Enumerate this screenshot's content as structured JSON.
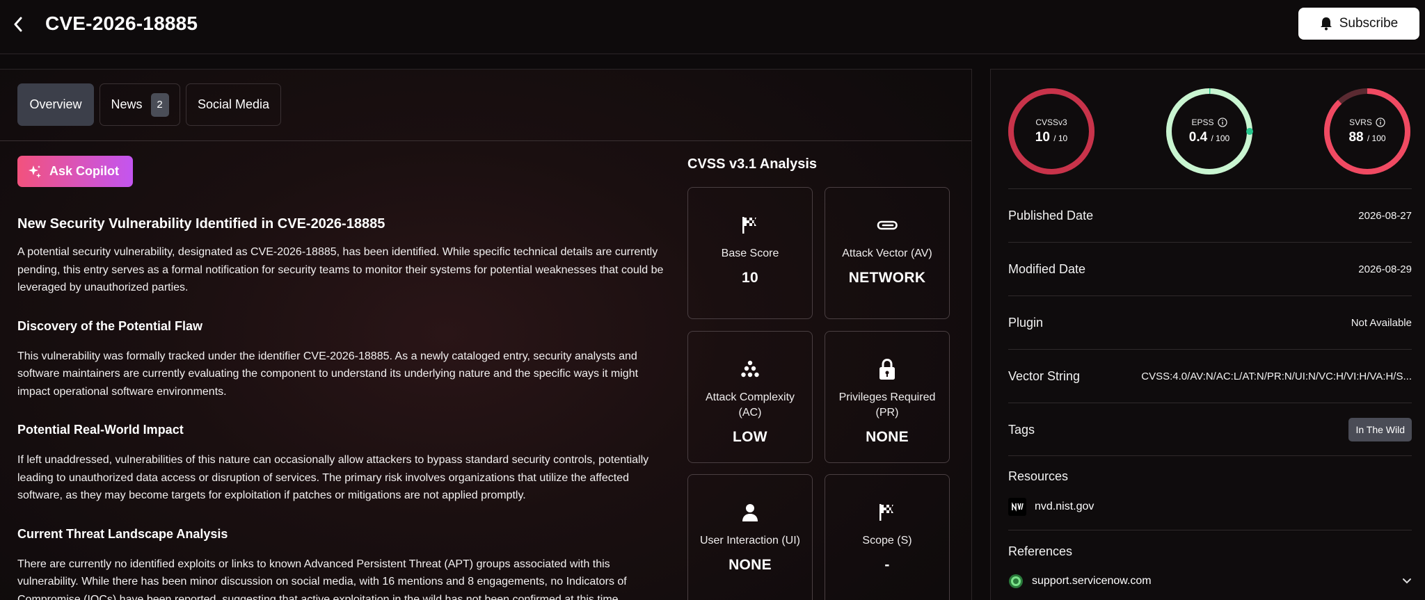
{
  "header": {
    "title": "CVE-2026-18885",
    "subscribe_label": "Subscribe"
  },
  "tabs": [
    {
      "label": "Overview",
      "active": true
    },
    {
      "label": "News",
      "count": "2"
    },
    {
      "label": "Social Media"
    }
  ],
  "copilot_label": "Ask Copilot",
  "article": {
    "title": "New Security Vulnerability Identified in CVE-2026-18885",
    "intro": "A potential security vulnerability, designated as CVE-2026-18885, has been identified. While specific technical details are currently pending, this entry serves as a formal notification for security teams to monitor their systems for potential weaknesses that could be leveraged by unauthorized parties.",
    "sections": [
      {
        "heading": "Discovery of the Potential Flaw",
        "body": "This vulnerability was formally tracked under the identifier CVE-2026-18885. As a newly cataloged entry, security analysts and software maintainers are currently evaluating the component to understand its underlying nature and the specific ways it might impact operational software environments."
      },
      {
        "heading": "Potential Real-World Impact",
        "body": "If left unaddressed, vulnerabilities of this nature can occasionally allow attackers to bypass standard security controls, potentially leading to unauthorized data access or disruption of services. The primary risk involves organizations that utilize the affected software, as they may become targets for exploitation if patches or mitigations are not applied promptly."
      },
      {
        "heading": "Current Threat Landscape Analysis",
        "body": "There are currently no identified exploits or links to known Advanced Persistent Threat (APT) groups associated with this vulnerability. While there has been minor discussion on social media, with 16 mentions and 8 engagements, no Indicators of Compromise (IOCs) have been reported, suggesting that active exploitation in the wild has not been confirmed at this time."
      }
    ]
  },
  "cvss": {
    "title": "CVSS v3.1 Analysis",
    "cards": [
      {
        "label": "Base Score",
        "value": "10",
        "icon": "flag-icon"
      },
      {
        "label": "Attack Vector (AV)",
        "value": "NETWORK",
        "icon": "paperclip-icon"
      },
      {
        "label": "Attack Complexity (AC)",
        "value": "LOW",
        "icon": "dots-icon"
      },
      {
        "label": "Privileges Required (PR)",
        "value": "NONE",
        "icon": "lock-icon"
      },
      {
        "label": "User Interaction (UI)",
        "value": "NONE",
        "icon": "user-icon"
      },
      {
        "label": "Scope (S)",
        "value": "-",
        "icon": "flag-icon"
      }
    ]
  },
  "gauges": [
    {
      "name": "CVSSv3",
      "score": "10",
      "max": "/ 10",
      "fraction": 1.0,
      "color": "#c8334a",
      "info": false
    },
    {
      "name": "EPSS",
      "score": "0.4",
      "max": "/ 100",
      "fraction": 0.004,
      "color": "#25c58c",
      "track": "#c9f5d1",
      "info": true
    },
    {
      "name": "SVRS",
      "score": "88",
      "max": "/ 100",
      "fraction": 0.88,
      "color": "#f04a62",
      "info": true
    }
  ],
  "details": [
    {
      "key": "Published Date",
      "value": "2026-08-27"
    },
    {
      "key": "Modified Date",
      "value": "2026-08-29"
    },
    {
      "key": "Plugin",
      "value": "Not Available"
    },
    {
      "key": "Vector String",
      "value": "CVSS:4.0/AV:N/AC:L/AT:N/PR:N/UI:N/VC:H/VI:H/VA:H/S..."
    },
    {
      "key": "Tags",
      "value": "In The Wild"
    }
  ],
  "resources": {
    "title": "Resources",
    "items": [
      "nvd.nist.gov"
    ]
  },
  "references": {
    "title": "References",
    "items": [
      "support.servicenow.com"
    ]
  },
  "colors": {
    "accent_gradient_start": "#f2527d",
    "accent_gradient_end": "#c355f0",
    "tab_active": "#3c3f4a"
  }
}
